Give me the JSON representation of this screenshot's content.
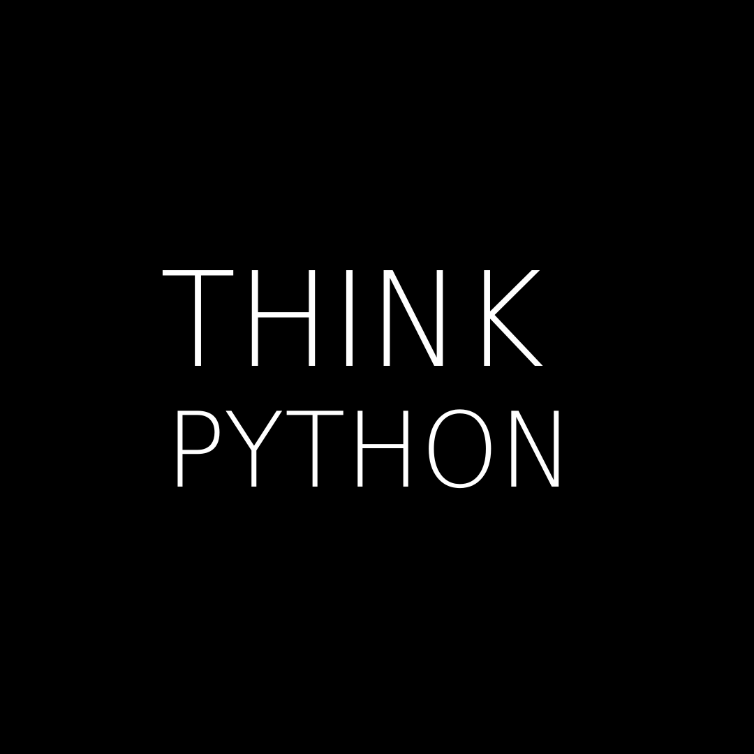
{
  "theme": {
    "background_color": "#000000",
    "text_color": "#ffffff"
  },
  "title": {
    "line1": "THINK",
    "line2": "PYTHON"
  }
}
